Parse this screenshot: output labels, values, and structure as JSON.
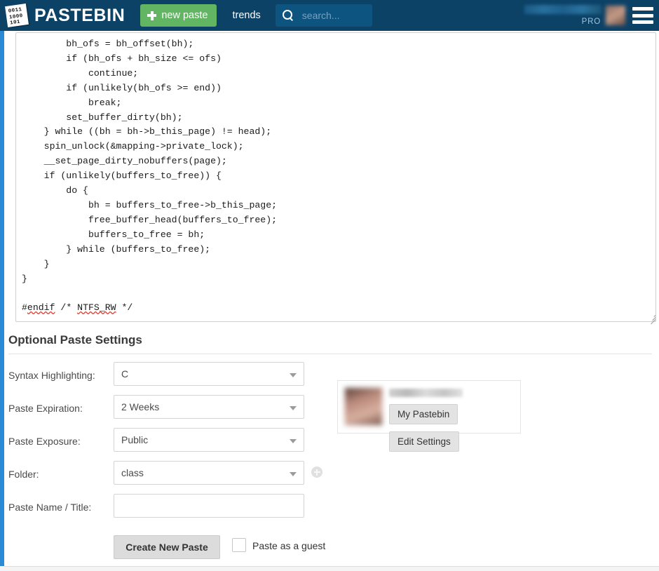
{
  "header": {
    "brand": "PASTEBIN",
    "logo_bits": [
      "0011",
      "1000",
      "101"
    ],
    "new_paste_label": "new paste",
    "trends_label": "trends",
    "search_placeholder": "search...",
    "search_value": "",
    "pro_badge": "PRO",
    "username_redacted": true,
    "background_color": "#0d4267",
    "new_paste_color": "#62b562",
    "search_box_color": "#0e5480"
  },
  "paste": {
    "code": "        bh_ofs = bh_offset(bh);\n        if (bh_ofs + bh_size <= ofs)\n            continue;\n        if (unlikely(bh_ofs >= end))\n            break;\n        set_buffer_dirty(bh);\n    } while ((bh = bh->b_this_page) != head);\n    spin_unlock(&mapping->private_lock);\n    __set_page_dirty_nobuffers(page);\n    if (unlikely(buffers_to_free)) {\n        do {\n            bh = buffers_to_free->b_this_page;\n            free_buffer_head(buffers_to_free);\n            buffers_to_free = bh;\n        } while (buffers_to_free);\n    }\n}\n\n#endif /* NTFS_RW */",
    "spellcheck_words": [
      "endif",
      "NTFS_RW"
    ]
  },
  "settings": {
    "title": "Optional Paste Settings",
    "fields": [
      {
        "label": "Syntax Highlighting:",
        "value": "C",
        "type": "select"
      },
      {
        "label": "Paste Expiration:",
        "value": "2 Weeks",
        "type": "select"
      },
      {
        "label": "Paste Exposure:",
        "value": "Public",
        "type": "select"
      },
      {
        "label": "Folder:",
        "value": "class",
        "type": "select"
      },
      {
        "label": "Paste Name / Title:",
        "value": "",
        "type": "text"
      }
    ],
    "add_folder_icon": "plus-circle-icon",
    "submit_label": "Create New Paste",
    "guest_label": "Paste as a guest",
    "guest_checked": false
  },
  "profile": {
    "username_redacted": true,
    "avatar_redacted": true,
    "my_pastebin_label": "My Pastebin",
    "edit_settings_label": "Edit Settings"
  }
}
